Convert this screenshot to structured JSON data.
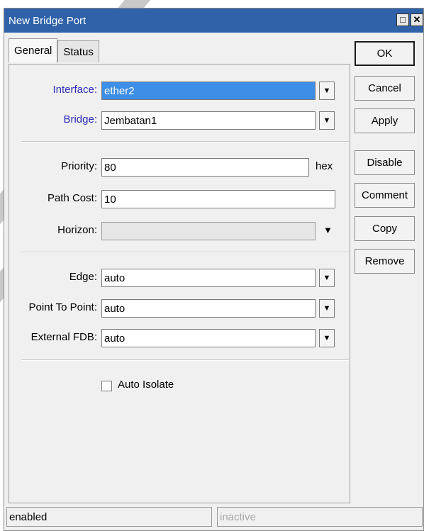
{
  "window": {
    "title": "New Bridge Port",
    "restore_icon": "restore-window-icon",
    "close_icon": "close-icon"
  },
  "tabs": [
    {
      "label": "General",
      "active": true
    },
    {
      "label": "Status",
      "active": false
    }
  ],
  "form": {
    "interface": {
      "label": "Interface:",
      "value": "ether2"
    },
    "bridge": {
      "label": "Bridge:",
      "value": "Jembatan1"
    },
    "priority": {
      "label": "Priority:",
      "value": "80",
      "unit": "hex"
    },
    "path_cost": {
      "label": "Path Cost:",
      "value": "10"
    },
    "horizon": {
      "label": "Horizon:",
      "value": ""
    },
    "edge": {
      "label": "Edge:",
      "value": "auto"
    },
    "point_to_point": {
      "label": "Point To Point:",
      "value": "auto"
    },
    "external_fdb": {
      "label": "External FDB:",
      "value": "auto"
    },
    "auto_isolate": {
      "label": "Auto Isolate",
      "checked": false
    }
  },
  "buttons": {
    "ok": "OK",
    "cancel": "Cancel",
    "apply": "Apply",
    "disable": "Disable",
    "comment": "Comment",
    "copy": "Copy",
    "remove": "Remove"
  },
  "status_bar": {
    "left": "enabled",
    "right": "inactive"
  },
  "colors": {
    "titlebar": "#2f62a8",
    "selected_field": "#3d8ee6",
    "link_label": "#2c2cb8"
  }
}
